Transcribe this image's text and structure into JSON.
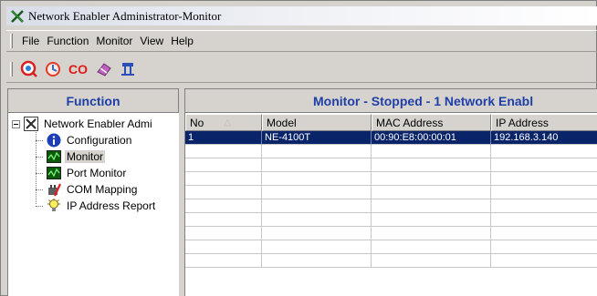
{
  "window": {
    "title": "Network Enabler Administrator-Monitor",
    "title_icon": "network-enabler-app-icon"
  },
  "menu": {
    "items": [
      {
        "label": "File",
        "mnemonic": "F"
      },
      {
        "label": "Function",
        "mnemonic": "u"
      },
      {
        "label": "Monitor",
        "mnemonic": "M"
      },
      {
        "label": "View",
        "mnemonic": "V"
      },
      {
        "label": "Help",
        "mnemonic": "H"
      }
    ]
  },
  "toolbar": {
    "buttons": [
      {
        "name": "search-icon"
      },
      {
        "name": "refresh-icon"
      },
      {
        "name": "co-icon",
        "text": "CO"
      },
      {
        "name": "eraser-icon"
      },
      {
        "name": "network-connect-icon"
      }
    ]
  },
  "function_pane": {
    "header": "Function",
    "root_label": "Network Enabler Admi",
    "items": [
      {
        "label": "Configuration",
        "icon": "info-icon",
        "selected": false
      },
      {
        "label": "Monitor",
        "icon": "monitor-icon",
        "selected": true
      },
      {
        "label": "Port Monitor",
        "icon": "monitor-icon",
        "selected": false
      },
      {
        "label": "COM Mapping",
        "icon": "com-mapping-icon",
        "selected": false
      },
      {
        "label": "IP Address Report",
        "icon": "lightbulb-icon",
        "selected": false
      }
    ]
  },
  "monitor_pane": {
    "header": "Monitor - Stopped - 1 Network Enabl",
    "columns": [
      "No",
      "Model",
      "MAC Address",
      "IP Address"
    ],
    "sort_indicator": "△",
    "rows": [
      {
        "no": "1",
        "model": "NE-4100T",
        "mac": "00:90:E8:00:00:01",
        "ip": "192.168.3.140"
      }
    ],
    "empty_rows": 9
  },
  "colors": {
    "header_text": "#1f3fa8",
    "selection_bg": "#0a246a",
    "chrome": "#d6d3ce"
  }
}
